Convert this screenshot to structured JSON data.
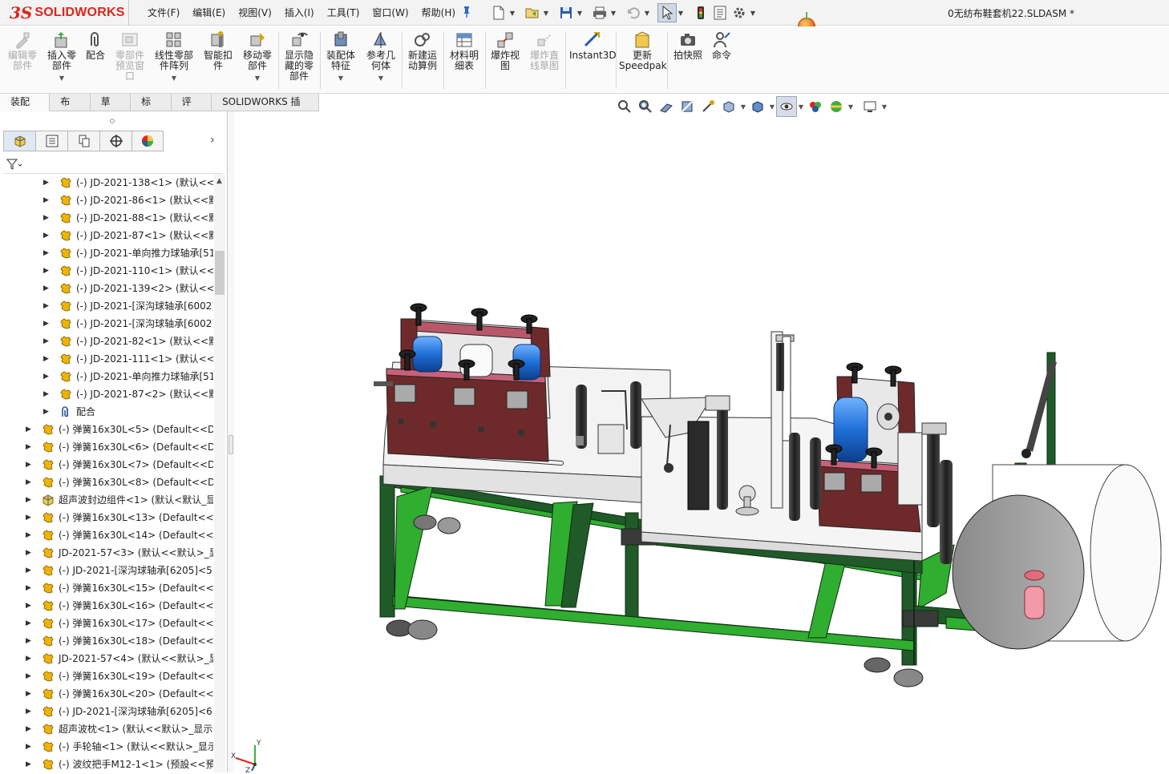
{
  "app": {
    "logo_prefix": "3S",
    "logo_name": "SOLIDWORKS",
    "document_title": "0无纺布鞋套机22.SLDASM *"
  },
  "menu": {
    "items": [
      "文件(F)",
      "编辑(E)",
      "视图(V)",
      "插入(I)",
      "工具(T)",
      "窗口(W)",
      "帮助(H)"
    ]
  },
  "commands": {
    "edit_component": "编辑零\n部件",
    "insert_components": "插入零\n部件",
    "mate": "配合",
    "component_preview": "零部件\n预览窗\n口",
    "linear_pattern": "线性零部\n件阵列",
    "smart_fasteners": "智能扣\n件",
    "move_component": "移动零\n部件",
    "show_hidden": "显示隐\n藏的零\n部件",
    "assembly_features": "装配体\n特征",
    "reference_geometry": "参考几\n何体",
    "new_motion_study": "新建运\n动算例",
    "bill_of_materials": "材料明\n细表",
    "exploded_view": "爆炸视\n图",
    "explode_line_sketch": "爆炸直\n线草图",
    "instant3d": "Instant3D",
    "update_speedpak": "更新\nSpeedpak",
    "take_snapshot": "拍快照",
    "command": "命令"
  },
  "tabs": [
    "装配体",
    "布局",
    "草图",
    "标注",
    "评估",
    "SOLIDWORKS 插件"
  ],
  "tree": {
    "rows": [
      {
        "level": 2,
        "icon": "part",
        "label": "(-) JD-2021-138<1> (默认<<默"
      },
      {
        "level": 2,
        "icon": "part",
        "label": "(-) JD-2021-86<1> (默认<<默"
      },
      {
        "level": 2,
        "icon": "part",
        "label": "(-) JD-2021-88<1> (默认<<默"
      },
      {
        "level": 2,
        "icon": "part",
        "label": "(-) JD-2021-87<1> (默认<<默"
      },
      {
        "level": 2,
        "icon": "part",
        "label": "(-) JD-2021-单向推力球轴承[51"
      },
      {
        "level": 2,
        "icon": "part",
        "label": "(-) JD-2021-110<1> (默认<<默"
      },
      {
        "level": 2,
        "icon": "part",
        "label": "(-) JD-2021-139<2> (默认<<默"
      },
      {
        "level": 2,
        "icon": "part",
        "label": "(-) JD-2021-[深沟球轴承[6002]"
      },
      {
        "level": 2,
        "icon": "part",
        "label": "(-) JD-2021-[深沟球轴承[6002]"
      },
      {
        "level": 2,
        "icon": "part",
        "label": "(-) JD-2021-82<1> (默认<<默"
      },
      {
        "level": 2,
        "icon": "part",
        "label": "(-) JD-2021-111<1> (默认<<默"
      },
      {
        "level": 2,
        "icon": "part",
        "label": "(-) JD-2021-单向推力球轴承[51"
      },
      {
        "level": 2,
        "icon": "part",
        "label": "(-) JD-2021-87<2> (默认<<默"
      },
      {
        "level": 2,
        "icon": "mates",
        "label": "配合"
      },
      {
        "level": 1,
        "icon": "part",
        "label": "(-) 弹簧16x30L<5> (Default<<Def"
      },
      {
        "level": 1,
        "icon": "part",
        "label": "(-) 弹簧16x30L<6> (Default<<Def"
      },
      {
        "level": 1,
        "icon": "part",
        "label": "(-) 弹簧16x30L<7> (Default<<Def"
      },
      {
        "level": 1,
        "icon": "part",
        "label": "(-) 弹簧16x30L<8> (Default<<Def"
      },
      {
        "level": 1,
        "icon": "assembly",
        "label": "超声波封边组件<1> (默认<默认_显"
      },
      {
        "level": 1,
        "icon": "part",
        "label": "(-) 弹簧16x30L<13> (Default<<De"
      },
      {
        "level": 1,
        "icon": "part",
        "label": "(-) 弹簧16x30L<14> (Default<<De"
      },
      {
        "level": 1,
        "icon": "part",
        "label": "JD-2021-57<3> (默认<<默认>_显"
      },
      {
        "level": 1,
        "icon": "part",
        "label": "(-) JD-2021-[深沟球轴承[6205]<5>"
      },
      {
        "level": 1,
        "icon": "part",
        "label": "(-) 弹簧16x30L<15> (Default<<De"
      },
      {
        "level": 1,
        "icon": "part",
        "label": "(-) 弹簧16x30L<16> (Default<<De"
      },
      {
        "level": 1,
        "icon": "part",
        "label": "(-) 弹簧16x30L<17> (Default<<De"
      },
      {
        "level": 1,
        "icon": "part",
        "label": "(-) 弹簧16x30L<18> (Default<<De"
      },
      {
        "level": 1,
        "icon": "part",
        "label": "JD-2021-57<4> (默认<<默认>_显"
      },
      {
        "level": 1,
        "icon": "part",
        "label": "(-) 弹簧16x30L<19> (Default<<De"
      },
      {
        "level": 1,
        "icon": "part",
        "label": "(-) 弹簧16x30L<20> (Default<<De"
      },
      {
        "level": 1,
        "icon": "part",
        "label": "(-) JD-2021-[深沟球轴承[6205]<6>"
      },
      {
        "level": 1,
        "icon": "part",
        "label": "超声波枕<1> (默认<<默认>_显示状"
      },
      {
        "level": 1,
        "icon": "part",
        "label": "(-) 手轮轴<1> (默认<<默认>_显示"
      },
      {
        "level": 1,
        "icon": "part",
        "label": "(-) 波纹把手M12-1<1> (预設<<預"
      }
    ]
  },
  "colors": {
    "accent": "#e2231a",
    "frame_green": "#1f5a28",
    "frame_light": "#2fae2f",
    "plate_brown": "#6e2a2a",
    "roller_blue": "#1f6fd8",
    "part_icon": "#f0b400"
  }
}
